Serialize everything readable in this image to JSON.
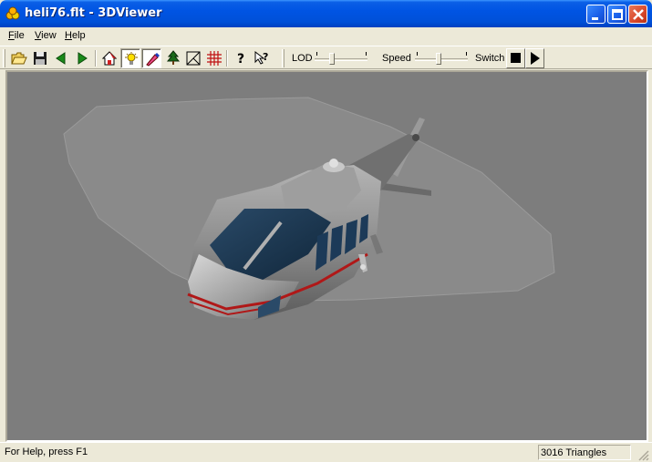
{
  "window": {
    "title": "heli76.flt - 3DViewer",
    "title_icon": "app-icon"
  },
  "menu": {
    "file": {
      "accel": "F",
      "rest": "ile"
    },
    "view": {
      "accel": "V",
      "rest": "iew"
    },
    "help": {
      "accel": "H",
      "rest": "elp"
    }
  },
  "toolbar": {
    "buttons": [
      "open-folder-icon",
      "save-disk-icon",
      "back-arrow-icon",
      "forward-arrow-icon",
      "home-icon",
      "light-icon",
      "paint-icon",
      "tree-icon",
      "perspective-icon",
      "grid-icon",
      "help-icon",
      "context-help-icon"
    ],
    "lod_label": "LOD",
    "speed_label": "Speed",
    "switch_label": "Switch",
    "lod_level": 0.3,
    "speed_level": 0.45
  },
  "status": {
    "help_text": "For Help, press F1",
    "triangles": "3016 Triangles"
  },
  "colors": {
    "title_blue": "#0054e3",
    "face": "#ece9d8",
    "viewport_bg": "#7d7d7d"
  }
}
